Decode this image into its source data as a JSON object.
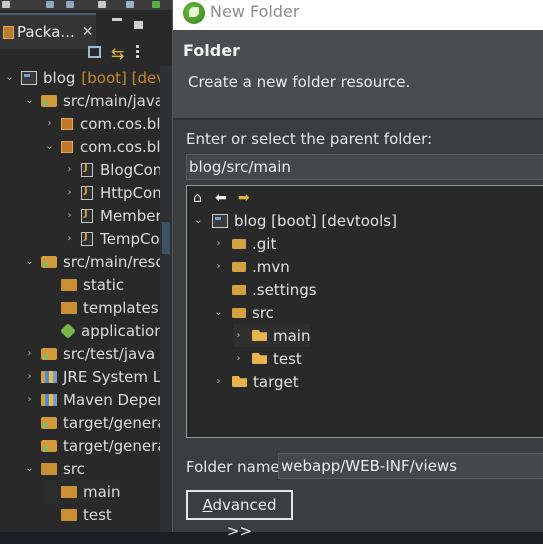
{
  "colors": {
    "dialog_bg": "#3c3d40",
    "header_bg": "#4b4c4f",
    "tree_bg": "#29292a",
    "explorer_bg": "#292929",
    "boot_tag": "#c68a2e",
    "accent_folder": "#e8b54d"
  },
  "explorer": {
    "tab_label": "Packa...",
    "tab_close": "✕",
    "toolbar": {
      "collapse_icon": "collapse-all-icon",
      "link_icon": "link-with-editor-icon",
      "menu_icon": "view-menu-icon",
      "link_glyph": "⇆"
    },
    "items": [
      {
        "label": "blog",
        "tag": "[boot] [devt",
        "icon": "project-icon",
        "chev": "⌄",
        "indent": 0
      },
      {
        "label": "src/main/java",
        "icon": "source-folder-icon",
        "chev": "⌄",
        "indent": 1
      },
      {
        "label": "com.cos.blo",
        "icon": "package-icon",
        "chev": "›",
        "indent": 2
      },
      {
        "label": "com.cos.blo",
        "icon": "package-icon",
        "chev": "⌄",
        "indent": 2
      },
      {
        "label": "BlogCon",
        "icon": "java-file-icon",
        "chev": "›",
        "indent": 3
      },
      {
        "label": "HttpCon",
        "icon": "java-file-icon",
        "chev": "›",
        "indent": 3
      },
      {
        "label": "Member",
        "icon": "java-file-icon",
        "chev": "›",
        "indent": 3
      },
      {
        "label": "TempCo",
        "icon": "java-file-icon",
        "chev": "›",
        "indent": 3
      },
      {
        "label": "src/main/resou",
        "icon": "source-folder-icon",
        "chev": "⌄",
        "indent": 1
      },
      {
        "label": "static",
        "icon": "folder-icon",
        "chev": "",
        "indent": 2
      },
      {
        "label": "templates",
        "icon": "folder-icon",
        "chev": "",
        "indent": 2
      },
      {
        "label": "application",
        "icon": "yaml-file-icon",
        "chev": "",
        "indent": 2
      },
      {
        "label": "src/test/java",
        "icon": "source-folder-icon",
        "chev": "›",
        "indent": 1
      },
      {
        "label": "JRE System Lib",
        "icon": "library-icon",
        "chev": "›",
        "indent": 1
      },
      {
        "label": "Maven Depen",
        "icon": "library-icon",
        "chev": "›",
        "indent": 1
      },
      {
        "label": "target/generat",
        "icon": "source-folder-icon",
        "chev": "",
        "indent": 1
      },
      {
        "label": "target/generat",
        "icon": "source-folder-icon",
        "chev": "",
        "indent": 1
      },
      {
        "label": "src",
        "icon": "folder-icon",
        "chev": "⌄",
        "indent": 1
      },
      {
        "label": "main",
        "icon": "folder-icon",
        "chev": "",
        "indent": 2,
        "selected": true
      },
      {
        "label": "test",
        "icon": "folder-icon",
        "chev": "",
        "indent": 2
      }
    ]
  },
  "dialog": {
    "window_title": "New Folder",
    "header_title": "Folder",
    "header_message": "Create a new folder resource.",
    "parent_label": "Enter or select the parent folder:",
    "parent_value": "blog/src/main",
    "tree_nav": {
      "home": "⌂",
      "back": "⬅",
      "forward": "➡"
    },
    "tree": [
      {
        "label": "blog  [boot] [devtools]",
        "icon": "project-icon",
        "chev": "⌄",
        "depth": 0
      },
      {
        "label": ".git",
        "icon": "folder-icon",
        "chev": "›",
        "depth": 1
      },
      {
        "label": ".mvn",
        "icon": "folder-icon",
        "chev": "›",
        "depth": 1
      },
      {
        "label": ".settings",
        "icon": "folder-icon",
        "chev": "",
        "depth": 1
      },
      {
        "label": "src",
        "icon": "folder-icon",
        "chev": "⌄",
        "depth": 1
      },
      {
        "label": "main",
        "icon": "open-folder-icon",
        "chev": "›",
        "depth": 2,
        "selected": true
      },
      {
        "label": "test",
        "icon": "open-folder-icon",
        "chev": "›",
        "depth": 2
      },
      {
        "label": "target",
        "icon": "open-folder-icon",
        "chev": "›",
        "depth": 1
      }
    ],
    "folder_name_label": "Folder name:",
    "folder_name_value": "webapp/WEB-INF/views",
    "advanced_button": "Advanced >>"
  }
}
